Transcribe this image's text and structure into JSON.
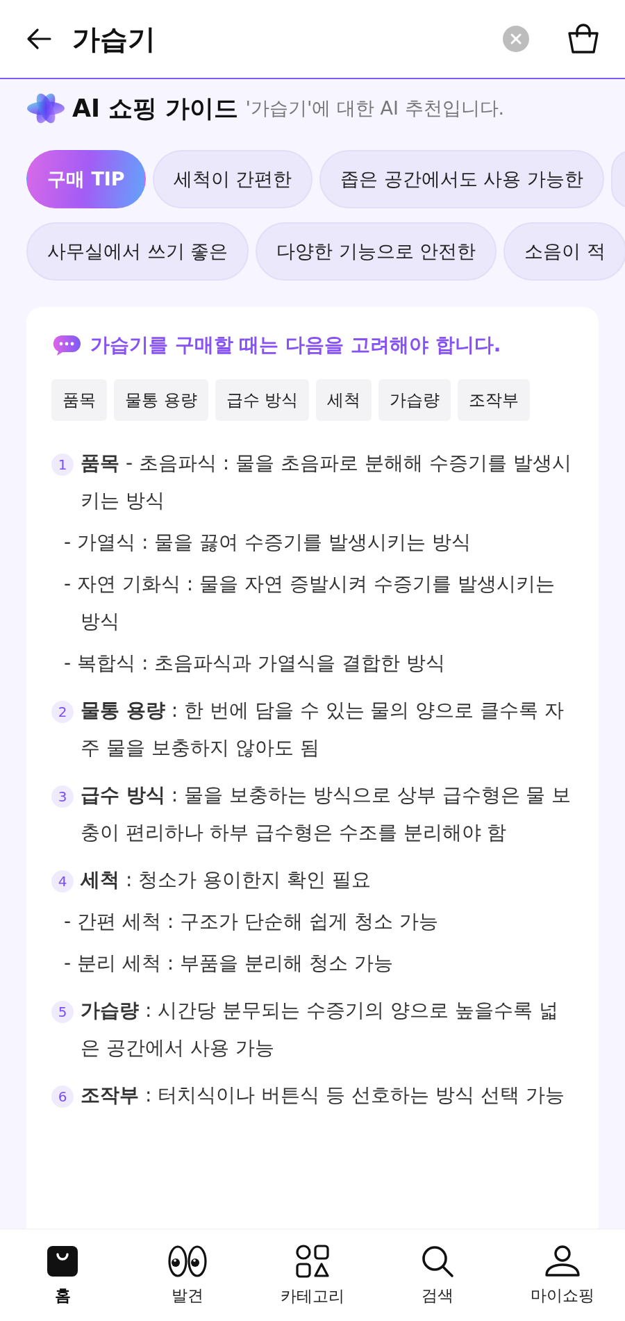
{
  "header": {
    "title": "가습기"
  },
  "guide": {
    "title": "AI 쇼핑 가이드",
    "subtitle": "'가습기'에 대한 AI 추천입니다."
  },
  "chip_rows": [
    [
      {
        "label": "구매 TIP",
        "selected": true
      },
      {
        "label": "세척이 간편한",
        "selected": false
      },
      {
        "label": "좁은 공간에서도 사용 가능한",
        "selected": false
      },
      {
        "selected": false
      }
    ],
    [
      {
        "label": "사무실에서 쓰기 좋은",
        "selected": false
      },
      {
        "label": "다양한 기능으로 안전한",
        "selected": false
      },
      {
        "label": "소음이 적",
        "selected": false
      }
    ]
  ],
  "tip_card": {
    "heading": "가습기를 구매할 때는 다음을 고려해야 합니다.",
    "tags": [
      "품목",
      "물통 용량",
      "급수 방식",
      "세척",
      "가습량",
      "조작부"
    ],
    "items": [
      {
        "number": "1",
        "text": "**품목** - 초음파식 : 물을 초음파로 분해해 수증기를 발생시키는 방식",
        "children": [
          {
            "text": "- 가열식 : 물을 끓여 수증기를 발생시키는 방식"
          },
          {
            "text": "- 자연 기화식 : 물을 자연 증발시켜 수증기를 발생시키는 방식"
          },
          {
            "text": "- 복합식 : 초음파식과 가열식을 결합한 방식"
          }
        ]
      },
      {
        "number": "2",
        "text": "**물통 용량** : 한 번에 담을 수 있는 물의 양으로 클수록 자주 물을 보충하지 않아도 됨"
      },
      {
        "number": "3",
        "text": "**급수 방식** : 물을 보충하는 방식으로 상부 급수형은 물 보충이 편리하나 하부 급수형은 수조를 분리해야 함"
      },
      {
        "number": "4",
        "text": "**세척** : 청소가 용이한지 확인 필요",
        "children": [
          {
            "text": "- 간편 세척 : 구조가 단순해 쉽게 청소 가능"
          },
          {
            "text": "- 분리 세척 : 부품을 분리해 청소 가능"
          }
        ]
      },
      {
        "number": "5",
        "text": "**가습량** : 시간당 분무되는 수증기의 양으로 높을수록 넓은 공간에서 사용 가능"
      },
      {
        "number": "6",
        "text": "**조작부** : 터치식이나 버튼식 등 선호하는 방식 선택 가능"
      }
    ]
  },
  "bottom_nav": [
    {
      "kind": "bag",
      "label": "홈",
      "selected": true
    },
    {
      "kind": "eyes",
      "label": "발견",
      "selected": false
    },
    {
      "kind": "category",
      "label": "카테고리",
      "selected": false
    },
    {
      "kind": "search",
      "label": "검색",
      "selected": false
    },
    {
      "kind": "person",
      "label": "마이쇼핑",
      "selected": false
    }
  ]
}
